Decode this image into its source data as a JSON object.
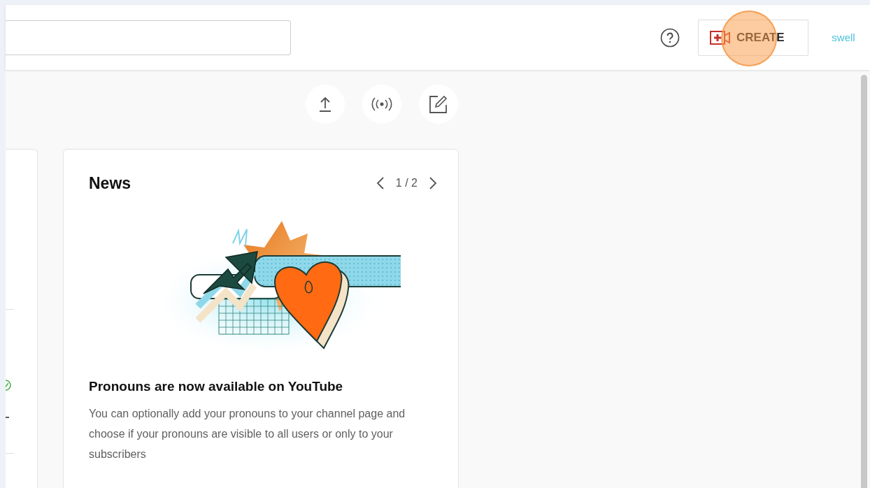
{
  "header": {
    "create_button": {
      "label": "CREATE"
    },
    "logo": {
      "text": "swell"
    }
  },
  "news": {
    "title": "News",
    "pager": "1 / 2",
    "headline": "Pronouns are now available on YouTube",
    "body": "You can optionally add your pronouns to your channel page and choose if your pronouns are visible to all users or only to your subscribers"
  }
}
